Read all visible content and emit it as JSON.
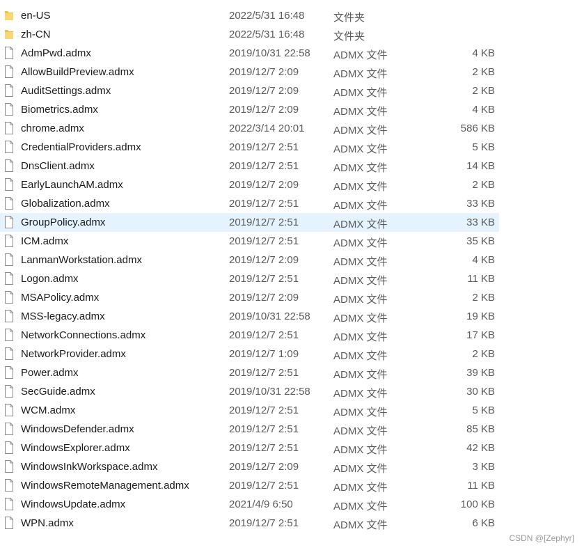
{
  "files": {
    "items": [
      {
        "name": "en-US",
        "date": "2022/5/31 16:48",
        "type": "文件夹",
        "size": "",
        "icon": "folder-icon"
      },
      {
        "name": "zh-CN",
        "date": "2022/5/31 16:48",
        "type": "文件夹",
        "size": "",
        "icon": "folder-icon"
      },
      {
        "name": "AdmPwd.admx",
        "date": "2019/10/31 22:58",
        "type": "ADMX 文件",
        "size": "4 KB",
        "icon": "file-icon"
      },
      {
        "name": "AllowBuildPreview.admx",
        "date": "2019/12/7 2:09",
        "type": "ADMX 文件",
        "size": "2 KB",
        "icon": "file-icon"
      },
      {
        "name": "AuditSettings.admx",
        "date": "2019/12/7 2:09",
        "type": "ADMX 文件",
        "size": "2 KB",
        "icon": "file-icon"
      },
      {
        "name": "Biometrics.admx",
        "date": "2019/12/7 2:09",
        "type": "ADMX 文件",
        "size": "4 KB",
        "icon": "file-icon"
      },
      {
        "name": "chrome.admx",
        "date": "2022/3/14 20:01",
        "type": "ADMX 文件",
        "size": "586 KB",
        "icon": "file-icon"
      },
      {
        "name": "CredentialProviders.admx",
        "date": "2019/12/7 2:51",
        "type": "ADMX 文件",
        "size": "5 KB",
        "icon": "file-icon"
      },
      {
        "name": "DnsClient.admx",
        "date": "2019/12/7 2:51",
        "type": "ADMX 文件",
        "size": "14 KB",
        "icon": "file-icon"
      },
      {
        "name": "EarlyLaunchAM.admx",
        "date": "2019/12/7 2:09",
        "type": "ADMX 文件",
        "size": "2 KB",
        "icon": "file-icon"
      },
      {
        "name": "Globalization.admx",
        "date": "2019/12/7 2:51",
        "type": "ADMX 文件",
        "size": "33 KB",
        "icon": "file-icon"
      },
      {
        "name": "GroupPolicy.admx",
        "date": "2019/12/7 2:51",
        "type": "ADMX 文件",
        "size": "33 KB",
        "icon": "file-icon",
        "selected": true
      },
      {
        "name": "ICM.admx",
        "date": "2019/12/7 2:51",
        "type": "ADMX 文件",
        "size": "35 KB",
        "icon": "file-icon"
      },
      {
        "name": "LanmanWorkstation.admx",
        "date": "2019/12/7 2:09",
        "type": "ADMX 文件",
        "size": "4 KB",
        "icon": "file-icon"
      },
      {
        "name": "Logon.admx",
        "date": "2019/12/7 2:51",
        "type": "ADMX 文件",
        "size": "11 KB",
        "icon": "file-icon"
      },
      {
        "name": "MSAPolicy.admx",
        "date": "2019/12/7 2:09",
        "type": "ADMX 文件",
        "size": "2 KB",
        "icon": "file-icon"
      },
      {
        "name": "MSS-legacy.admx",
        "date": "2019/10/31 22:58",
        "type": "ADMX 文件",
        "size": "19 KB",
        "icon": "file-icon"
      },
      {
        "name": "NetworkConnections.admx",
        "date": "2019/12/7 2:51",
        "type": "ADMX 文件",
        "size": "17 KB",
        "icon": "file-icon"
      },
      {
        "name": "NetworkProvider.admx",
        "date": "2019/12/7 1:09",
        "type": "ADMX 文件",
        "size": "2 KB",
        "icon": "file-icon"
      },
      {
        "name": "Power.admx",
        "date": "2019/12/7 2:51",
        "type": "ADMX 文件",
        "size": "39 KB",
        "icon": "file-icon"
      },
      {
        "name": "SecGuide.admx",
        "date": "2019/10/31 22:58",
        "type": "ADMX 文件",
        "size": "30 KB",
        "icon": "file-icon"
      },
      {
        "name": "WCM.admx",
        "date": "2019/12/7 2:51",
        "type": "ADMX 文件",
        "size": "5 KB",
        "icon": "file-icon"
      },
      {
        "name": "WindowsDefender.admx",
        "date": "2019/12/7 2:51",
        "type": "ADMX 文件",
        "size": "85 KB",
        "icon": "file-icon"
      },
      {
        "name": "WindowsExplorer.admx",
        "date": "2019/12/7 2:51",
        "type": "ADMX 文件",
        "size": "42 KB",
        "icon": "file-icon"
      },
      {
        "name": "WindowsInkWorkspace.admx",
        "date": "2019/12/7 2:09",
        "type": "ADMX 文件",
        "size": "3 KB",
        "icon": "file-icon"
      },
      {
        "name": "WindowsRemoteManagement.admx",
        "date": "2019/12/7 2:51",
        "type": "ADMX 文件",
        "size": "11 KB",
        "icon": "file-icon"
      },
      {
        "name": "WindowsUpdate.admx",
        "date": "2021/4/9 6:50",
        "type": "ADMX 文件",
        "size": "100 KB",
        "icon": "file-icon"
      },
      {
        "name": "WPN.admx",
        "date": "2019/12/7 2:51",
        "type": "ADMX 文件",
        "size": "6 KB",
        "icon": "file-icon"
      }
    ]
  },
  "colors": {
    "folder": "#f0c23b",
    "selection": "#e5f3ff"
  },
  "watermark": "CSDN @[Zephyr]"
}
